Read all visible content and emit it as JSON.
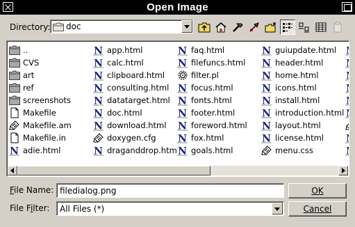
{
  "window": {
    "title": "Open Image"
  },
  "directory": {
    "label": "Directory:",
    "value": "doc"
  },
  "toolbar": {
    "buttons": [
      {
        "name": "up-directory-icon"
      },
      {
        "name": "home-icon"
      },
      {
        "name": "work-directory-icon"
      },
      {
        "name": "bookmark-icon"
      },
      {
        "name": "new-folder-icon"
      },
      {
        "name": "small-icons-view-icon",
        "active": true
      },
      {
        "name": "big-icons-view-icon"
      },
      {
        "name": "details-view-icon"
      },
      {
        "name": "delete-icon",
        "disabled": true
      }
    ]
  },
  "files": {
    "columns": [
      [
        {
          "name": "..",
          "type": "folder"
        },
        {
          "name": "CVS",
          "type": "folder"
        },
        {
          "name": "art",
          "type": "folder"
        },
        {
          "name": "ref",
          "type": "folder"
        },
        {
          "name": "screenshots",
          "type": "folder"
        },
        {
          "name": "Makefile",
          "type": "doc"
        },
        {
          "name": "Makefile.am",
          "type": "source"
        },
        {
          "name": "Makefile.in",
          "type": "doc"
        },
        {
          "name": "adie.html",
          "type": "html"
        }
      ],
      [
        {
          "name": "app.html",
          "type": "html"
        },
        {
          "name": "calc.html",
          "type": "html"
        },
        {
          "name": "clipboard.html",
          "type": "html"
        },
        {
          "name": "consulting.html",
          "type": "html"
        },
        {
          "name": "datatarget.html",
          "type": "html"
        },
        {
          "name": "doc.html",
          "type": "html"
        },
        {
          "name": "download.html",
          "type": "html"
        },
        {
          "name": "doxygen.cfg",
          "type": "source"
        },
        {
          "name": "draganddrop.html",
          "type": "html"
        }
      ],
      [
        {
          "name": "faq.html",
          "type": "html"
        },
        {
          "name": "filefuncs.html",
          "type": "html"
        },
        {
          "name": "filter.pl",
          "type": "gear"
        },
        {
          "name": "focus.html",
          "type": "html"
        },
        {
          "name": "fonts.html",
          "type": "html"
        },
        {
          "name": "footer.html",
          "type": "html"
        },
        {
          "name": "foreword.html",
          "type": "html"
        },
        {
          "name": "fox.html",
          "type": "html"
        },
        {
          "name": "goals.html",
          "type": "html"
        }
      ],
      [
        {
          "name": "guiupdate.html",
          "type": "html"
        },
        {
          "name": "header.html",
          "type": "html"
        },
        {
          "name": "home.html",
          "type": "html"
        },
        {
          "name": "icons.html",
          "type": "html"
        },
        {
          "name": "install.html",
          "type": "html"
        },
        {
          "name": "introduction.html",
          "type": "html"
        },
        {
          "name": "layout.html",
          "type": "html"
        },
        {
          "name": "license.html",
          "type": "html"
        },
        {
          "name": "menu.css",
          "type": "source"
        }
      ],
      [
        {
          "name": "",
          "type": "html"
        },
        {
          "name": "",
          "type": "html"
        },
        {
          "name": "",
          "type": "html"
        },
        {
          "name": "",
          "type": "html"
        },
        {
          "name": "",
          "type": "html"
        },
        {
          "name": "",
          "type": "html"
        },
        {
          "name": "",
          "type": "source"
        },
        {
          "name": "",
          "type": "html"
        },
        {
          "name": "",
          "type": "html"
        }
      ]
    ]
  },
  "filename": {
    "label": "File Name:",
    "value": "filedialog.png"
  },
  "filter": {
    "label": "File Filter:",
    "value": "All Files (*)"
  },
  "buttons": {
    "ok": "OK",
    "cancel": "Cancel"
  },
  "colors": {
    "titlebar": "#000000",
    "face": "#d4d0c8",
    "html_icon": "#1a237e",
    "folder": "#a8a8a8"
  }
}
